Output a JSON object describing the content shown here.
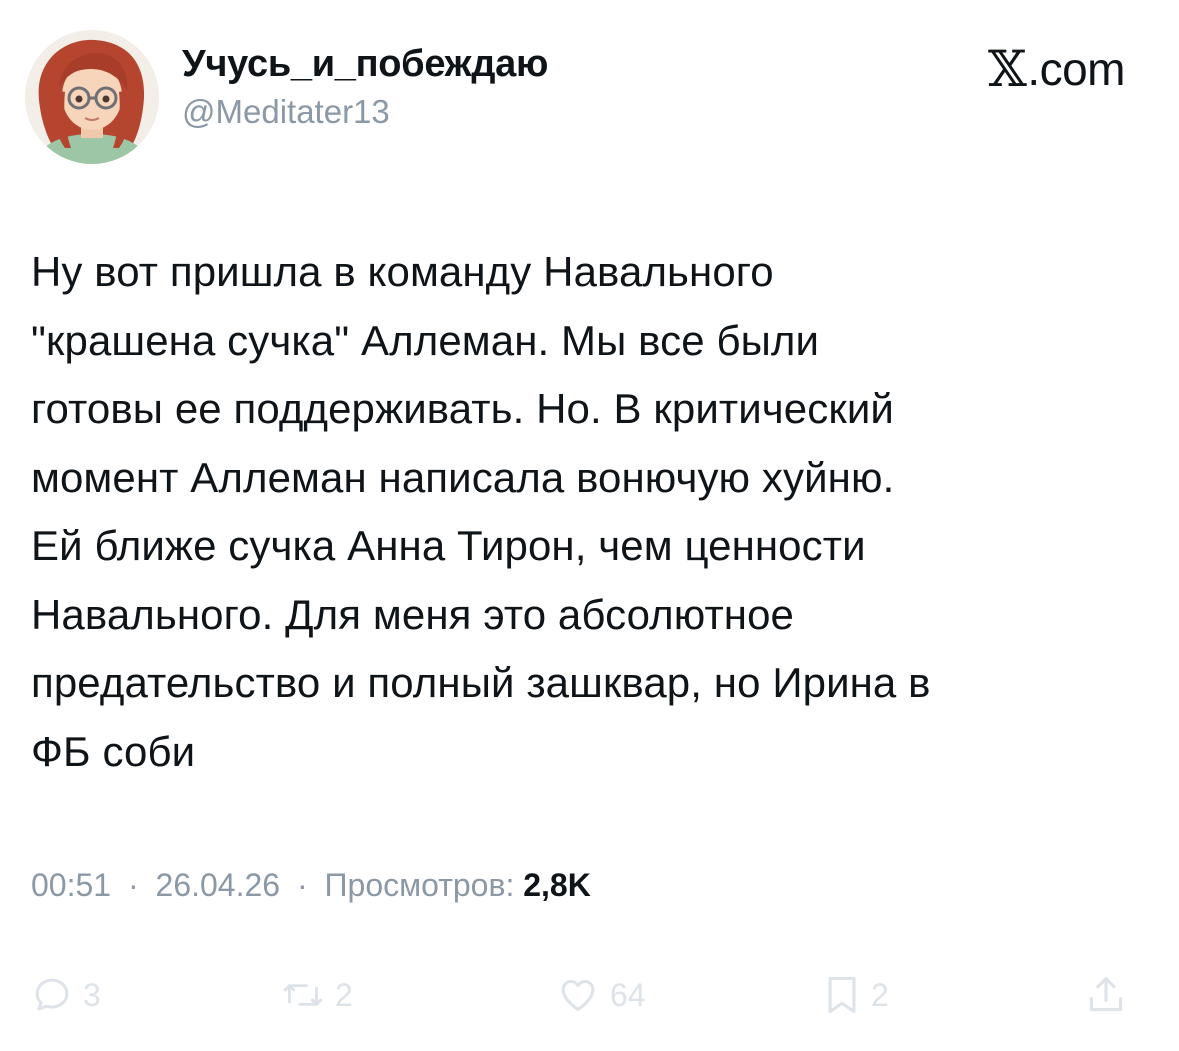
{
  "author": {
    "display_name": "Учусь_и_побеждаю",
    "handle": "@Meditater13"
  },
  "brand": {
    "x": "𝕏",
    "domain": ".com"
  },
  "tweet": {
    "lines": [
      "Ну вот пришла в команду Навального",
      "\"крашена сучка\" Аллеман. Мы все были",
      "готовы ее поддерживать. Но. В критический",
      "момент Аллеман написала вонючую хуйню.",
      "Ей ближе сучка Анна Тирон, чем ценности",
      "Навального. Для меня это абсолютное",
      "предательство и полный зашквар, но Ирина в",
      "ФБ соби"
    ]
  },
  "meta": {
    "time": "00:51",
    "separator": "·",
    "date": "26.04.26",
    "views_label": "Просмотров:",
    "views_value": "2,8K"
  },
  "actions": {
    "replies": "3",
    "reposts": "2",
    "likes": "64",
    "bookmarks": "2"
  },
  "icons": {
    "reply": "reply-icon",
    "repost": "repost-icon",
    "like": "like-icon",
    "bookmark": "bookmark-icon",
    "share": "share-icon"
  },
  "colors": {
    "text": "#0f1419",
    "secondary_text": "#8b98a5",
    "faded_actions": "#dde3e8",
    "background": "#ffffff"
  }
}
